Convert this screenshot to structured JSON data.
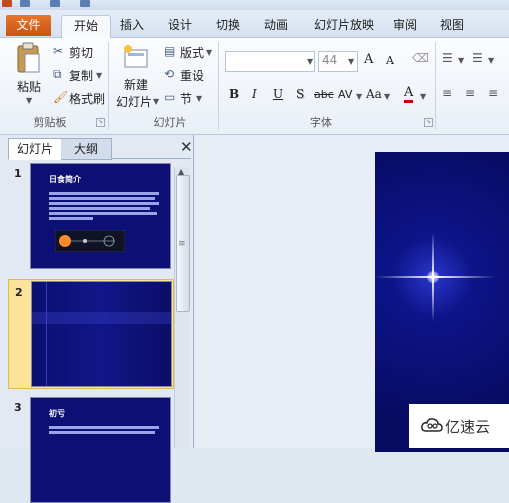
{
  "tabs": {
    "file": "文件",
    "home": "开始",
    "insert": "插入",
    "design": "设计",
    "transitions": "切换",
    "animations": "动画",
    "slideshow": "幻灯片放映",
    "review": "审阅",
    "view": "视图"
  },
  "clipboard": {
    "paste": "粘贴",
    "cut": "剪切",
    "copy": "复制",
    "format_painter": "格式刷",
    "group": "剪贴板"
  },
  "slides": {
    "new_slide_line1": "新建",
    "new_slide_line2": "幻灯片",
    "layout": "版式",
    "reset": "重设",
    "section": "节",
    "group": "幻灯片"
  },
  "font": {
    "size": "44",
    "grow": "A",
    "shrink": "A",
    "bold": "B",
    "italic": "I",
    "underline": "U",
    "shadow": "S",
    "strike": "abc",
    "spacing": "AV",
    "change_case": "Aa",
    "color": "A",
    "group": "字体"
  },
  "panel": {
    "tab_slides": "幻灯片",
    "tab_outline": "大纲",
    "close": "✕"
  },
  "thumbnails": [
    {
      "number": "1",
      "title": "日食简介"
    },
    {
      "number": "2",
      "title": ""
    },
    {
      "number": "3",
      "title": "初亏"
    }
  ],
  "watermark": {
    "text": "亿速云"
  }
}
